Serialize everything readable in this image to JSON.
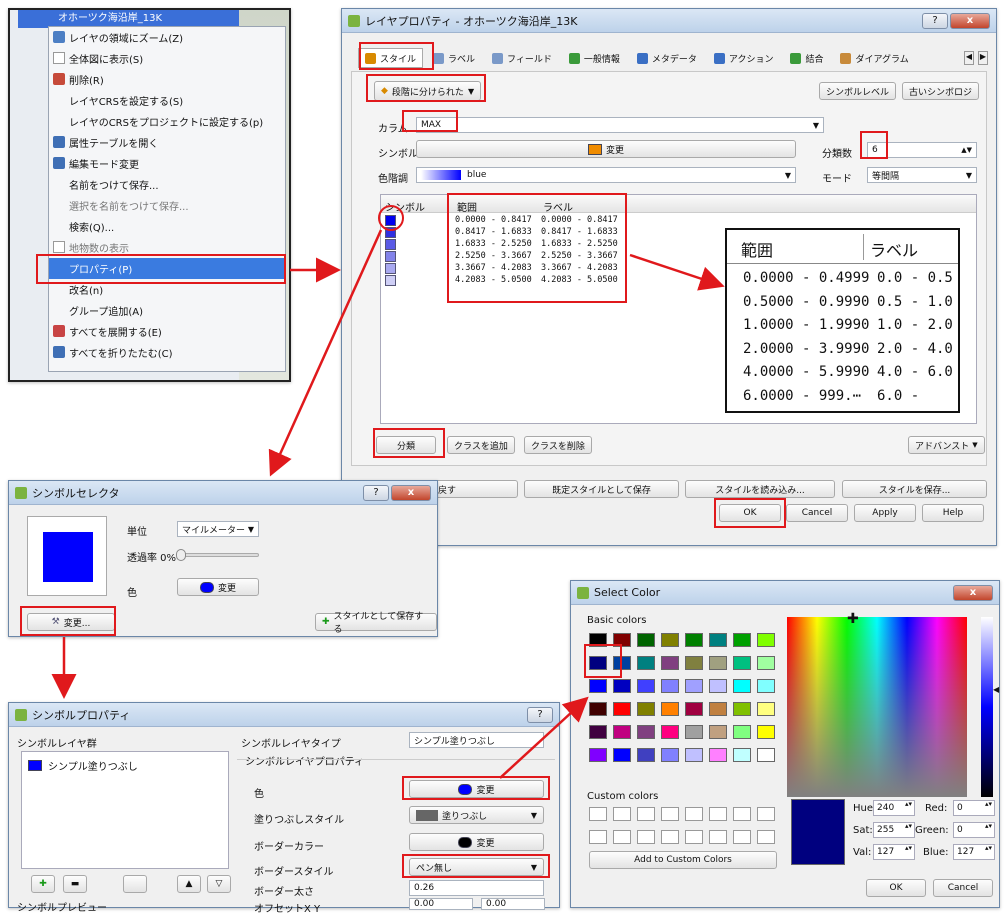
{
  "context_menu": {
    "layer_label": "オホーツク海沿岸_13K",
    "items": [
      "レイヤの領域にズーム(Z)",
      "全体図に表示(S)",
      "削除(R)",
      "レイヤCRSを設定する(S)",
      "レイヤのCRSをプロジェクトに設定する(p)",
      "属性テーブルを開く",
      "編集モード変更",
      "名前をつけて保存...",
      "選択を名前をつけて保存...",
      "検索(Q)...",
      "地物数の表示",
      "プロパティ(P)",
      "改名(n)",
      "グループ追加(A)",
      "すべてを展開する(E)",
      "すべてを折りたたむ(C)"
    ]
  },
  "layer_props": {
    "title": "レイヤプロパティ - オホーツク海沿岸_13K",
    "tabs": [
      "スタイル",
      "ラベル",
      "フィールド",
      "一般情報",
      "メタデータ",
      "アクション",
      "結合",
      "ダイアグラム"
    ],
    "renderer": "段階に分けられた",
    "symbol_levels": "シンボルレベル",
    "old_symbology": "古いシンボロジ",
    "column_label": "カラム",
    "column_value": "MAX",
    "symbol_label": "シンボル",
    "symbol_change": "変更",
    "classes_label": "分類数",
    "classes_value": "6",
    "ramp_label": "色階調",
    "ramp_value": "blue",
    "mode_label": "モード",
    "mode_value": "等間隔",
    "table_headers": [
      "シンボル",
      "範囲",
      "ラベル"
    ],
    "rows": [
      {
        "range": "0.0000 - 0.8417",
        "label": "0.0000 - 0.8417",
        "color": "#0000f0"
      },
      {
        "range": "0.8417 - 1.6833",
        "label": "0.8417 - 1.6833",
        "color": "#2f2fe0"
      },
      {
        "range": "1.6833 - 2.5250",
        "label": "1.6833 - 2.5250",
        "color": "#5a5ae6"
      },
      {
        "range": "2.5250 - 3.3667",
        "label": "2.5250 - 3.3667",
        "color": "#8383ea"
      },
      {
        "range": "3.3667 - 4.2083",
        "label": "3.3667 - 4.2083",
        "color": "#a9a9f0"
      },
      {
        "range": "4.2083 - 5.0500",
        "label": "4.2083 - 5.0500",
        "color": "#cfcff6"
      }
    ],
    "classify": "分類",
    "add_class": "クラスを追加",
    "delete_class": "クラスを削除",
    "advanced": "アドバンスト",
    "restore": "ルに戻す",
    "save_default": "既定スタイルとして保存",
    "load_style": "スタイルを読み込み...",
    "save_style": "スタイルを保存...",
    "ok": "OK",
    "cancel": "Cancel",
    "apply": "Apply",
    "help": "Help"
  },
  "callout": {
    "headers": [
      "範囲",
      "ラベル"
    ],
    "rows": [
      {
        "range": "0.0000 - 0.4999",
        "label": "0.0 - 0.5"
      },
      {
        "range": "0.5000 - 0.9990",
        "label": "0.5 - 1.0"
      },
      {
        "range": "1.0000 - 1.9990",
        "label": "1.0 - 2.0"
      },
      {
        "range": "2.0000 - 3.9990",
        "label": "2.0 - 4.0"
      },
      {
        "range": "4.0000 - 5.9990",
        "label": "4.0 - 6.0"
      },
      {
        "range": "6.0000 - 999.⋯",
        "label": "6.0 -"
      }
    ]
  },
  "symbol_selector": {
    "title": "シンボルセレクタ",
    "unit_label": "単位",
    "unit_value": "マイルメーター",
    "transparency_label": "透過率 0%",
    "color_label": "色",
    "change": "変更",
    "edit": "変更...",
    "save_as_style": "スタイルとして保存する",
    "preview_color": "#0000ff"
  },
  "symbol_props": {
    "title": "シンボルプロパティ",
    "layers_label": "シンボルレイヤ群",
    "layer_item": "シンプル塗りつぶし",
    "layer_type_label": "シンボルレイヤタイプ",
    "layer_type_value": "シンプル塗りつぶし",
    "layer_props_label": "シンボルレイヤプロパティ",
    "color_label": "色",
    "color_change": "変更",
    "fill_style_label": "塗りつぶしスタイル",
    "fill_style_value": "塗りつぶし",
    "border_color_label": "ボーダーカラー",
    "border_color_change": "変更",
    "border_style_label": "ボーダースタイル",
    "border_style_value": "ペン無し",
    "border_width_label": "ボーダー太さ",
    "border_width_value": "0.26",
    "offset_label": "オフセットX Y",
    "offset_x": "0.00",
    "offset_y": "0.00",
    "preview_label": "シンボルプレビュー"
  },
  "select_color": {
    "title": "Select Color",
    "basic_colors_label": "Basic colors",
    "custom_colors_label": "Custom colors",
    "add_custom": "Add to Custom Colors",
    "basic_colors": [
      "#000000",
      "#800000",
      "#006400",
      "#808000",
      "#008000",
      "#008080",
      "#00a000",
      "#80ff00",
      "#000080",
      "#0040a0",
      "#008080",
      "#804080",
      "#808040",
      "#a0a080",
      "#00c080",
      "#a0ffa0",
      "#0000ff",
      "#0000c0",
      "#4040ff",
      "#8080ff",
      "#a0a0ff",
      "#c0c0ff",
      "#00ffff",
      "#80ffff",
      "#400000",
      "#ff0000",
      "#808000",
      "#ff8000",
      "#a00040",
      "#c08040",
      "#80c000",
      "#ffff80",
      "#400040",
      "#c00080",
      "#804080",
      "#ff0080",
      "#a0a0a0",
      "#c0a080",
      "#80ff80",
      "#ffff00",
      "#8000ff",
      "#0000ff",
      "#4040c0",
      "#8080ff",
      "#c0c0ff",
      "#ff80ff",
      "#c0ffff",
      "#ffffff"
    ],
    "hue_label": "Hue:",
    "hue": "240",
    "sat_label": "Sat:",
    "sat": "255",
    "val_label": "Val:",
    "val": "127",
    "red_label": "Red:",
    "red": "0",
    "green_label": "Green:",
    "green": "0",
    "blue_label": "Blue:",
    "blue": "127",
    "current_color": "#00007f",
    "ok": "OK",
    "cancel": "Cancel"
  }
}
